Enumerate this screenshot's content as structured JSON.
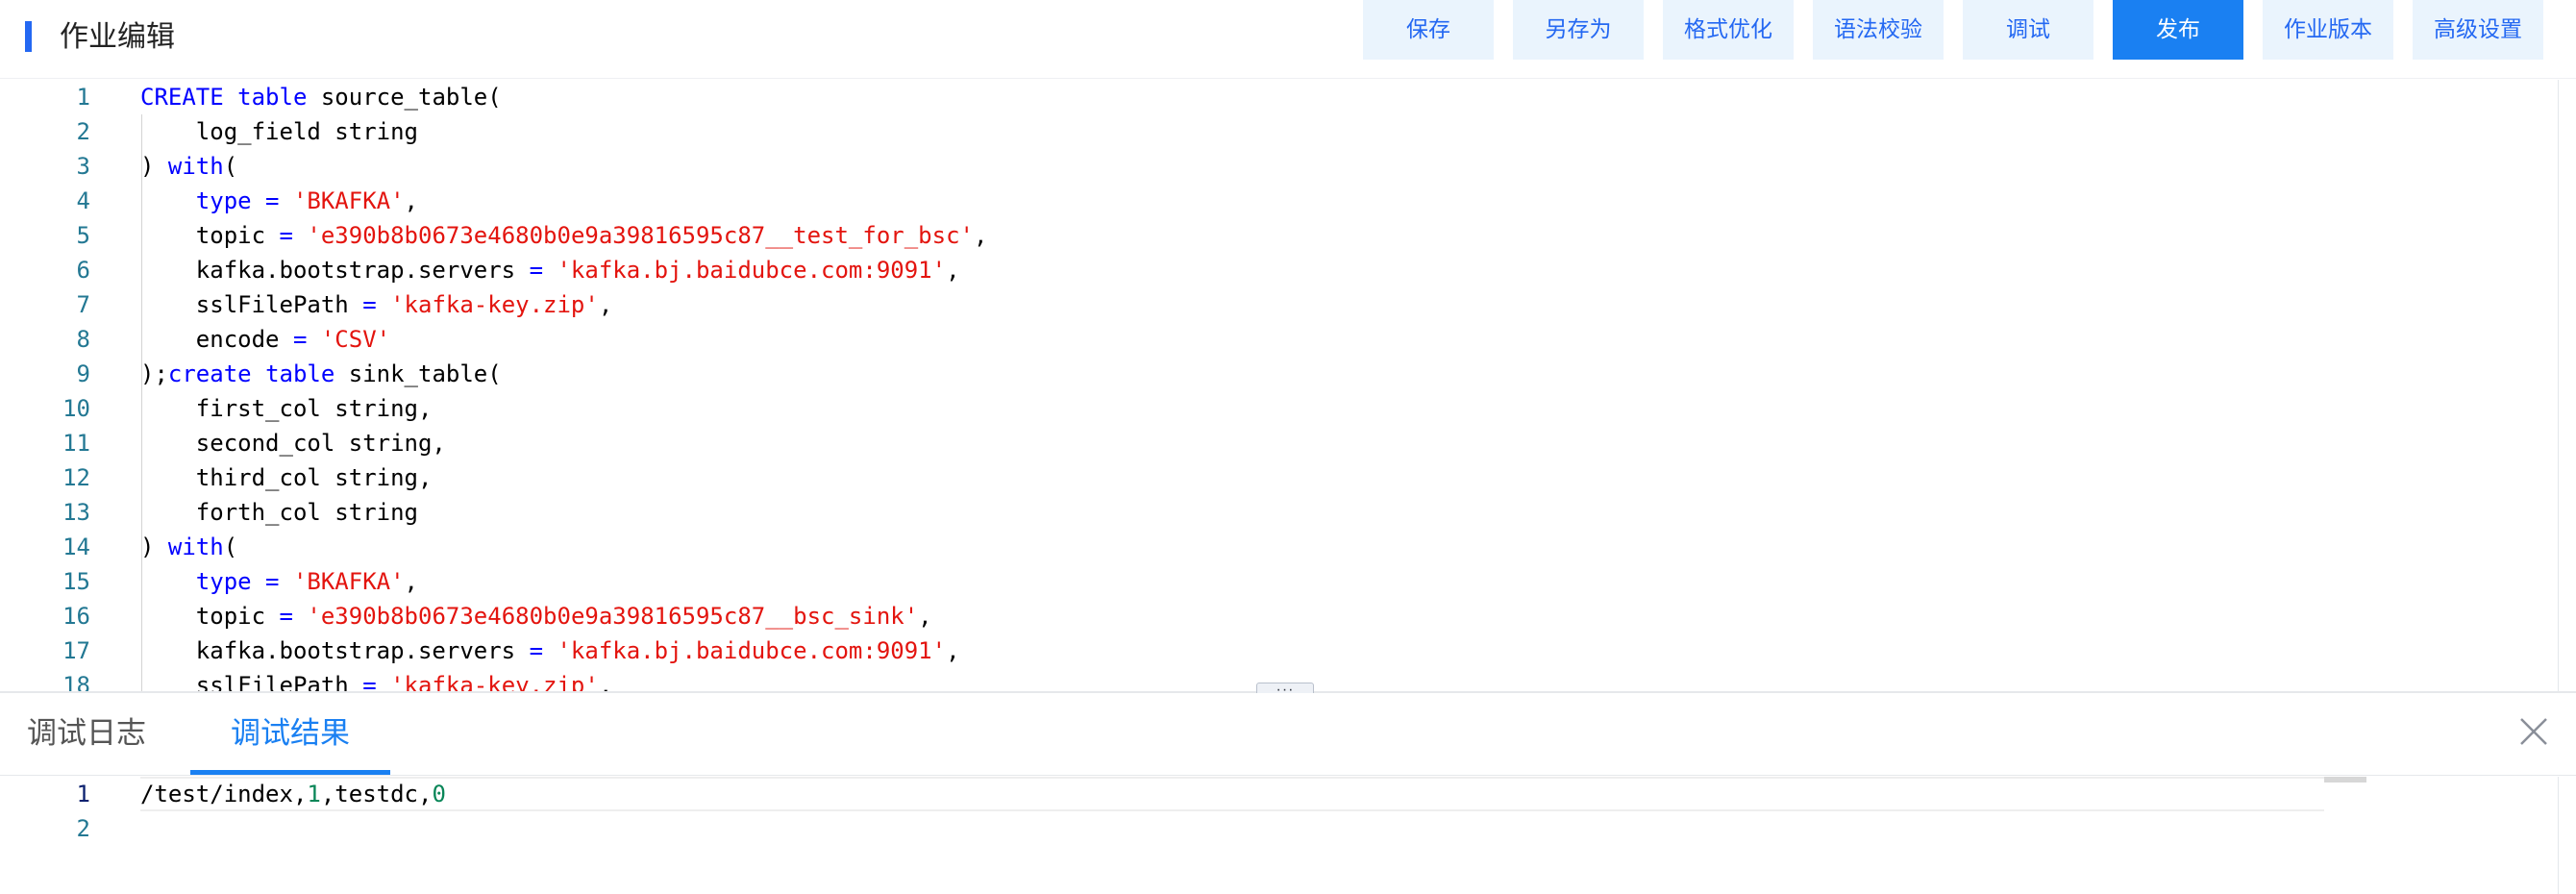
{
  "header": {
    "title": "作业编辑",
    "accent_color": "#2468f2"
  },
  "toolbar": {
    "save": "保存",
    "save_as": "另存为",
    "format": "格式优化",
    "syntax_check": "语法校验",
    "debug": "调试",
    "publish": "发布",
    "versions": "作业版本",
    "advanced": "高级设置",
    "primary_color": "#1a80f2"
  },
  "editor": {
    "lines": [
      {
        "n": "1",
        "segs": [
          [
            "kw",
            "CREATE"
          ],
          [
            "t",
            " "
          ],
          [
            "kw",
            "table"
          ],
          [
            "t",
            " source_table("
          ]
        ]
      },
      {
        "n": "2",
        "segs": [
          [
            "t",
            "    log_field string"
          ]
        ]
      },
      {
        "n": "3",
        "segs": [
          [
            "t",
            ") "
          ],
          [
            "kw",
            "with"
          ],
          [
            "t",
            "("
          ]
        ]
      },
      {
        "n": "4",
        "segs": [
          [
            "t",
            "    "
          ],
          [
            "kw",
            "type"
          ],
          [
            "t",
            " "
          ],
          [
            "op",
            "="
          ],
          [
            "t",
            " "
          ],
          [
            "str",
            "'BKAFKA'"
          ],
          [
            "t",
            ","
          ]
        ]
      },
      {
        "n": "5",
        "segs": [
          [
            "t",
            "    topic "
          ],
          [
            "op",
            "="
          ],
          [
            "t",
            " "
          ],
          [
            "str",
            "'e390b8b0673e4680b0e9a39816595c87__test_for_bsc'"
          ],
          [
            "t",
            ","
          ]
        ]
      },
      {
        "n": "6",
        "segs": [
          [
            "t",
            "    kafka.bootstrap.servers "
          ],
          [
            "op",
            "="
          ],
          [
            "t",
            " "
          ],
          [
            "str",
            "'kafka.bj.baidubce.com:9091'"
          ],
          [
            "t",
            ","
          ]
        ]
      },
      {
        "n": "7",
        "segs": [
          [
            "t",
            "    sslFilePath "
          ],
          [
            "op",
            "="
          ],
          [
            "t",
            " "
          ],
          [
            "str",
            "'kafka-key.zip'"
          ],
          [
            "t",
            ","
          ]
        ]
      },
      {
        "n": "8",
        "segs": [
          [
            "t",
            "    encode "
          ],
          [
            "op",
            "="
          ],
          [
            "t",
            " "
          ],
          [
            "str",
            "'CSV'"
          ]
        ]
      },
      {
        "n": "9",
        "segs": [
          [
            "t",
            ");"
          ],
          [
            "kw",
            "create"
          ],
          [
            "t",
            " "
          ],
          [
            "kw",
            "table"
          ],
          [
            "t",
            " sink_table("
          ]
        ]
      },
      {
        "n": "10",
        "segs": [
          [
            "t",
            "    first_col string,"
          ]
        ]
      },
      {
        "n": "11",
        "segs": [
          [
            "t",
            "    second_col string,"
          ]
        ]
      },
      {
        "n": "12",
        "segs": [
          [
            "t",
            "    third_col string,"
          ]
        ]
      },
      {
        "n": "13",
        "segs": [
          [
            "t",
            "    forth_col string"
          ]
        ]
      },
      {
        "n": "14",
        "segs": [
          [
            "t",
            ") "
          ],
          [
            "kw",
            "with"
          ],
          [
            "t",
            "("
          ]
        ]
      },
      {
        "n": "15",
        "segs": [
          [
            "t",
            "    "
          ],
          [
            "kw",
            "type"
          ],
          [
            "t",
            " "
          ],
          [
            "op",
            "="
          ],
          [
            "t",
            " "
          ],
          [
            "str",
            "'BKAFKA'"
          ],
          [
            "t",
            ","
          ]
        ]
      },
      {
        "n": "16",
        "segs": [
          [
            "t",
            "    topic "
          ],
          [
            "op",
            "="
          ],
          [
            "t",
            " "
          ],
          [
            "str",
            "'e390b8b0673e4680b0e9a39816595c87__bsc_sink'"
          ],
          [
            "t",
            ","
          ]
        ]
      },
      {
        "n": "17",
        "segs": [
          [
            "t",
            "    kafka.bootstrap.servers "
          ],
          [
            "op",
            "="
          ],
          [
            "t",
            " "
          ],
          [
            "str",
            "'kafka.bj.baidubce.com:9091'"
          ],
          [
            "t",
            ","
          ]
        ]
      },
      {
        "n": "18",
        "segs": [
          [
            "t",
            "    sslFilePath "
          ],
          [
            "op",
            "="
          ],
          [
            "t",
            " "
          ],
          [
            "str",
            "'kafka-key.zip'"
          ],
          [
            "t",
            ","
          ]
        ]
      }
    ]
  },
  "splitter": {
    "handle_glyph": "···"
  },
  "panel": {
    "tabs": [
      {
        "label": "调试日志",
        "active": false
      },
      {
        "label": "调试结果",
        "active": true
      }
    ],
    "close_icon": "close-icon",
    "result_lines": [
      {
        "n": "1",
        "segs": [
          [
            "t",
            "/test/index,"
          ],
          [
            "num",
            "1"
          ],
          [
            "t",
            ",testdc,"
          ],
          [
            "num",
            "0"
          ]
        ]
      },
      {
        "n": "2",
        "segs": []
      }
    ]
  }
}
